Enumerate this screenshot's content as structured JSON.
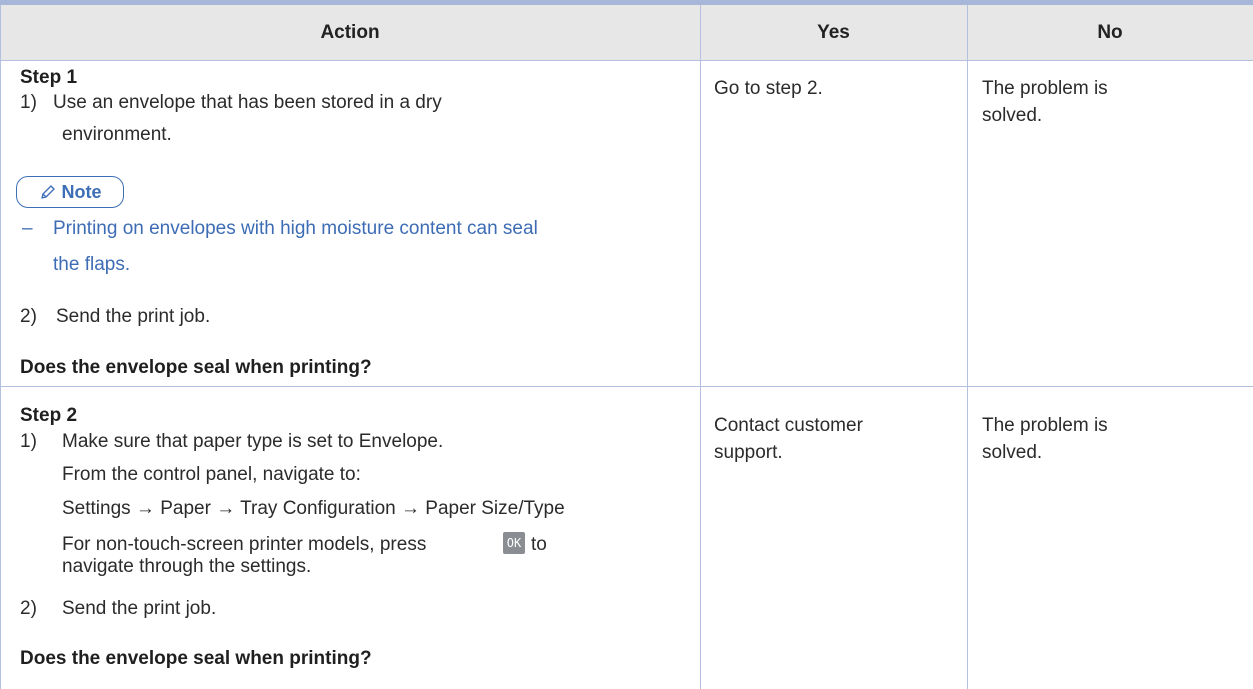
{
  "table": {
    "headers": {
      "action": "Action",
      "yes": "Yes",
      "no": "No"
    },
    "rows": [
      {
        "step_title": "Step 1",
        "item1_number": "1)",
        "item1_line1": "Use an envelope that has been stored in a dry",
        "item1_line2": "environment.",
        "note_label": "Note",
        "note_dash": "–",
        "note_line1": "Printing on envelopes with high moisture content can seal",
        "note_line2": "the flaps.",
        "item2_number": "2)",
        "item2_text": "Send the print job.",
        "question": "Does the envelope seal when printing?",
        "yes": "Go to step 2.",
        "no_line1": "The problem is",
        "no_line2": "solved."
      },
      {
        "step_title": "Step 2",
        "item1_number": "1)",
        "item1_text": "Make sure that paper type is set to Envelope.",
        "nav_intro": "From the control panel, navigate to:",
        "nav_path": "Settings → Paper → Tray Configuration → Paper Size/Type",
        "nontouch_line1_before": "For non-touch-screen printer models, press",
        "ok_key": "OK",
        "nontouch_line1_after": "to",
        "nontouch_line2": "navigate through the settings.",
        "item2_number": "2)",
        "item2_text": "Send the print job.",
        "question": "Does the envelope seal when printing?",
        "yes_line1": "Contact customer",
        "yes_line2": "support.",
        "no_line1": "The problem is",
        "no_line2": "solved."
      }
    ]
  }
}
